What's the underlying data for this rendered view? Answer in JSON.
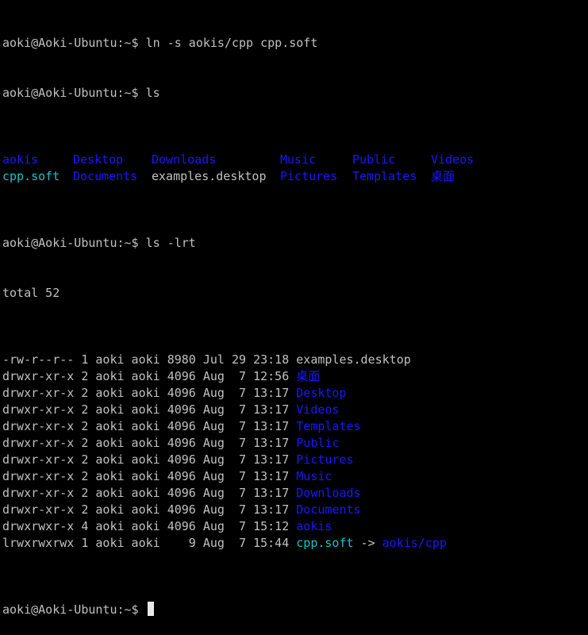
{
  "prompt_user": "aoki@Aoki-Ubuntu",
  "prompt_path": ":~$",
  "commands": [
    "ln -s aokis/cpp cpp.soft",
    "ls",
    "ls -lrt"
  ],
  "ls_output": [
    [
      {
        "text": "aokis",
        "type": "dir"
      },
      {
        "text": "Desktop",
        "type": "dir"
      },
      {
        "text": "Downloads",
        "type": "dir"
      },
      {
        "text": "Music",
        "type": "dir"
      },
      {
        "text": "Public",
        "type": "dir"
      },
      {
        "text": "Videos",
        "type": "dir"
      }
    ],
    [
      {
        "text": "cpp.soft",
        "type": "link"
      },
      {
        "text": "Documents",
        "type": "dir"
      },
      {
        "text": "examples.desktop",
        "type": "file"
      },
      {
        "text": "Pictures",
        "type": "dir"
      },
      {
        "text": "Templates",
        "type": "dir"
      },
      {
        "text": "桌面",
        "type": "dir"
      }
    ]
  ],
  "total_line": "total 52",
  "lrt_rows": [
    {
      "meta": "-rw-r--r-- 1 aoki aoki 8980 Jul 29 23:18 ",
      "name": "examples.desktop",
      "type": "file"
    },
    {
      "meta": "drwxr-xr-x 2 aoki aoki 4096 Aug  7 12:56 ",
      "name": "桌面",
      "type": "dir"
    },
    {
      "meta": "drwxr-xr-x 2 aoki aoki 4096 Aug  7 13:17 ",
      "name": "Desktop",
      "type": "dir"
    },
    {
      "meta": "drwxr-xr-x 2 aoki aoki 4096 Aug  7 13:17 ",
      "name": "Videos",
      "type": "dir"
    },
    {
      "meta": "drwxr-xr-x 2 aoki aoki 4096 Aug  7 13:17 ",
      "name": "Templates",
      "type": "dir"
    },
    {
      "meta": "drwxr-xr-x 2 aoki aoki 4096 Aug  7 13:17 ",
      "name": "Public",
      "type": "dir"
    },
    {
      "meta": "drwxr-xr-x 2 aoki aoki 4096 Aug  7 13:17 ",
      "name": "Pictures",
      "type": "dir"
    },
    {
      "meta": "drwxr-xr-x 2 aoki aoki 4096 Aug  7 13:17 ",
      "name": "Music",
      "type": "dir"
    },
    {
      "meta": "drwxr-xr-x 2 aoki aoki 4096 Aug  7 13:17 ",
      "name": "Downloads",
      "type": "dir"
    },
    {
      "meta": "drwxr-xr-x 2 aoki aoki 4096 Aug  7 13:17 ",
      "name": "Documents",
      "type": "dir"
    },
    {
      "meta": "drwxrwxr-x 4 aoki aoki 4096 Aug  7 15:12 ",
      "name": "aokis",
      "type": "dir"
    },
    {
      "meta": "lrwxrwxrwx 1 aoki aoki    9 Aug  7 15:44 ",
      "name": "cpp.soft",
      "type": "link",
      "arrow": " -> ",
      "target": "aokis/cpp",
      "target_type": "dir"
    }
  ],
  "colors": {
    "directory": "#1818ff",
    "symlink": "#19c3c9",
    "text": "#c0c0c0",
    "background": "#000000"
  }
}
